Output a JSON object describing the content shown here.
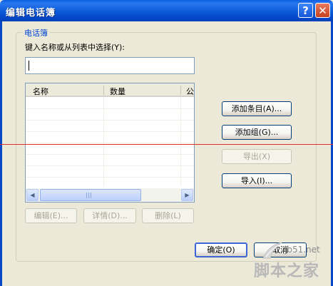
{
  "window": {
    "title": "编辑电话簿",
    "help_glyph": "?",
    "close_glyph": "✕"
  },
  "group": {
    "title": "电话簿"
  },
  "prompt": "键入名称或从列表中选择(Y):",
  "name_input": {
    "value": ""
  },
  "list": {
    "columns": [
      "名称",
      "数量",
      "公"
    ],
    "scroll_left": "◀",
    "scroll_right": "▶"
  },
  "buttons": {
    "add_entry": "添加条目(A)...",
    "add_group": "添加组(G)...",
    "export": "导出(X)",
    "import": "导入(I)...",
    "edit": "编辑(E)...",
    "details": "详情(D)...",
    "delete": "删除(L)",
    "ok": "确定(O)",
    "cancel": "取消"
  },
  "watermark": {
    "site": "jb51.net",
    "brand": "脚本之家"
  },
  "colors": {
    "title_bar": "#0a5ee3",
    "group_title": "#0046d5",
    "red_line": "#e0312a"
  }
}
